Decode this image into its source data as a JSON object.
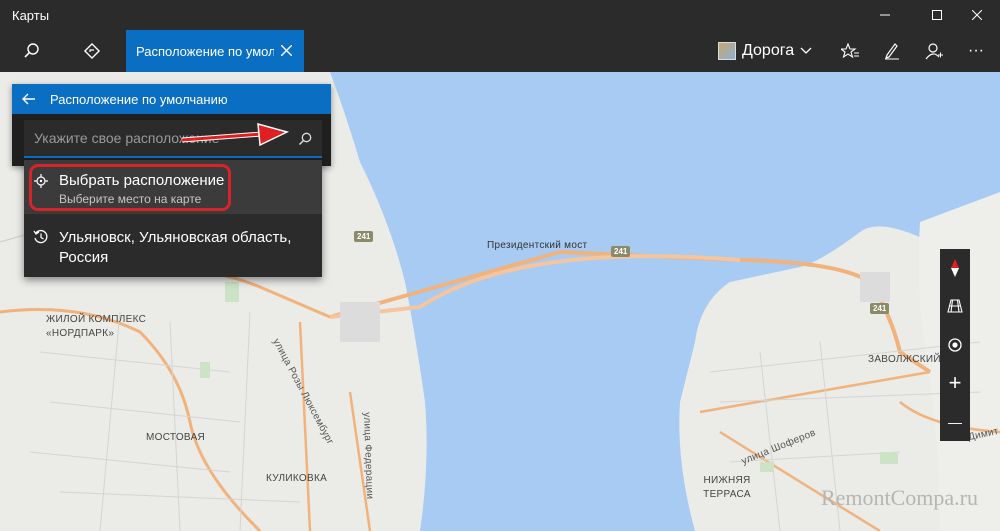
{
  "window": {
    "title": "Карты",
    "minimize": "—",
    "maximize": "☐",
    "close": "✕"
  },
  "toolbar": {
    "search_icon": "search-icon",
    "directions_icon": "directions-icon",
    "tab_label": "Расположение по умол",
    "map_style": "Дорога",
    "favorites_icon": "favorites-icon",
    "ink_icon": "ink-icon",
    "account_icon": "account-icon",
    "more_label": "···"
  },
  "panel": {
    "header": "Расположение по умолчанию",
    "search_placeholder": "Укажите свое расположение"
  },
  "options": [
    {
      "main": "Выбрать расположение",
      "sub": "Выберите место на карте"
    },
    {
      "main": "Ульяновск, Ульяновская область, Россия"
    }
  ],
  "map": {
    "bridge": "Президентский мост",
    "route_shield": "241",
    "labels": {
      "nordpark": "ЖИЛОЙ КОМПЛЕКС «НОРДПАРК»",
      "street_rosa": "улица Розы Люксембург",
      "street_fed": "улица Федерации",
      "mostovaya": "МОСТОВАЯ",
      "kulikovka": "КУЛИКОВКА",
      "zavolzhsky": "ЗАВОЛЖСКИЙ",
      "nizhnyaya": "НИЖНЯЯ ТЕРРАСА",
      "shoferov": "улица Шоферов",
      "dimit": "Димит"
    }
  },
  "controls": {
    "compass": "compass-icon",
    "tilt": "tilt-icon",
    "location": "location-icon",
    "zoom_in": "+",
    "zoom_out": "—"
  },
  "watermark": "RemontCompa.ru",
  "colors": {
    "accent": "#0a6fc2",
    "water": "#a7cbf2",
    "land": "#ebebe8",
    "road": "#f1b27b",
    "highlight": "#d9232a"
  }
}
